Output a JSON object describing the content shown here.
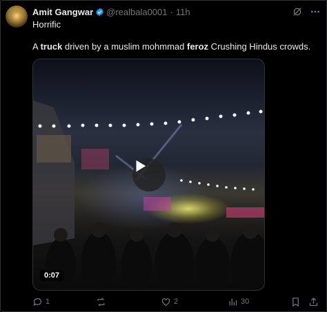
{
  "post": {
    "author_name": "Amit Gangwar",
    "handle": "@realbala0001",
    "separator": "·",
    "time": "11h",
    "line1": "Horrific",
    "line2_parts": [
      "A ",
      "truck",
      " driven by a muslim mohmmad ",
      "feroz",
      " Crushing Hindus crowds."
    ]
  },
  "media": {
    "duration": "0:07"
  },
  "actions": {
    "replies": "1",
    "reposts": "",
    "likes": "2",
    "views": "30"
  },
  "icons": [
    "verified-badge-icon",
    "grok-icon",
    "more-icon",
    "reply-icon",
    "repost-icon",
    "like-icon",
    "views-icon",
    "bookmark-icon",
    "share-icon",
    "play-icon"
  ],
  "colors": {
    "accent": "#1d9bf0",
    "muted": "#71767b",
    "text": "#e7e9ea",
    "background": "#000000"
  }
}
